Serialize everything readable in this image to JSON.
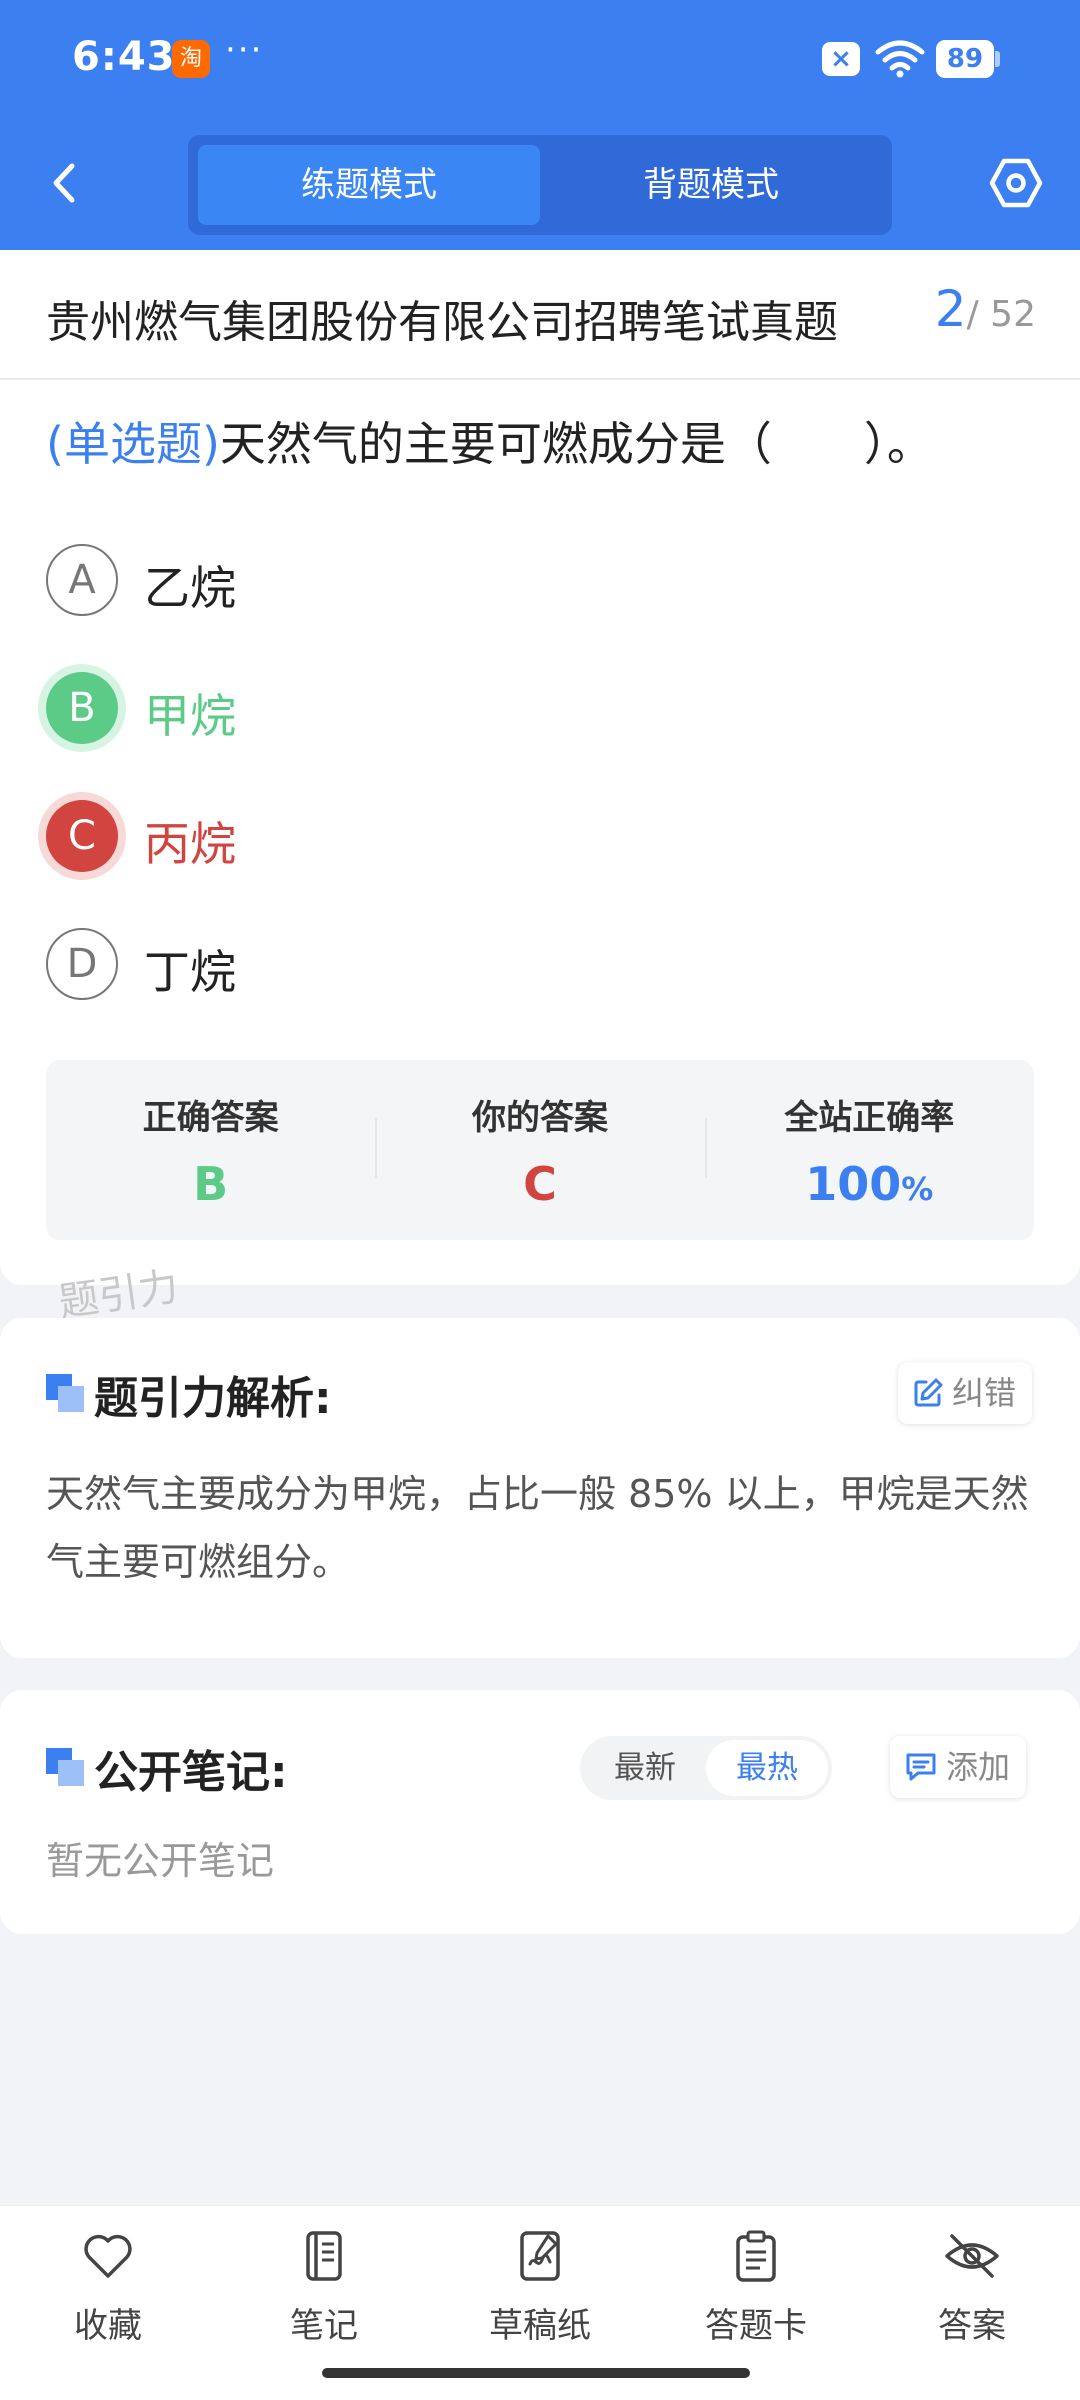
{
  "status_bar": {
    "time": "6:43",
    "app_badge": "淘",
    "more": "···",
    "battery": "89"
  },
  "header": {
    "modes": [
      "练题模式",
      "背题模式"
    ],
    "active_mode": 0
  },
  "exam": {
    "title": "贵州燃气集团股份有限公司招聘笔试真题",
    "current": "2",
    "total": "/ 52"
  },
  "question": {
    "type": "(单选题)",
    "text": "天然气的主要可燃成分是（　　）。",
    "options": [
      {
        "letter": "A",
        "text": "乙烷",
        "state": "normal"
      },
      {
        "letter": "B",
        "text": "甲烷",
        "state": "correct"
      },
      {
        "letter": "C",
        "text": "丙烷",
        "state": "wrong"
      },
      {
        "letter": "D",
        "text": "丁烷",
        "state": "normal"
      }
    ]
  },
  "stats": {
    "correct_label": "正确答案",
    "correct_value": "B",
    "yours_label": "你的答案",
    "yours_value": "C",
    "rate_label": "全站正确率",
    "rate_value": "100",
    "rate_unit": "%"
  },
  "watermark": "题引力",
  "analysis": {
    "title": "题引力解析:",
    "report_label": "纠错",
    "text": "天然气主要成分为甲烷，占比一般 85% 以上，甲烷是天然气主要可燃组分。"
  },
  "notes": {
    "title": "公开笔记:",
    "sort_options": [
      "最新",
      "最热"
    ],
    "active_sort": 1,
    "add_label": "添加",
    "empty_text": "暂无公开笔记"
  },
  "bottom_nav": [
    {
      "label": "收藏",
      "icon": "heart-icon"
    },
    {
      "label": "笔记",
      "icon": "notebook-icon"
    },
    {
      "label": "草稿纸",
      "icon": "draft-icon"
    },
    {
      "label": "答题卡",
      "icon": "clipboard-icon"
    },
    {
      "label": "答案",
      "icon": "eye-off-icon"
    }
  ],
  "colors": {
    "primary": "#3b7ff0",
    "correct": "#5ccb88",
    "wrong": "#d2443f"
  }
}
